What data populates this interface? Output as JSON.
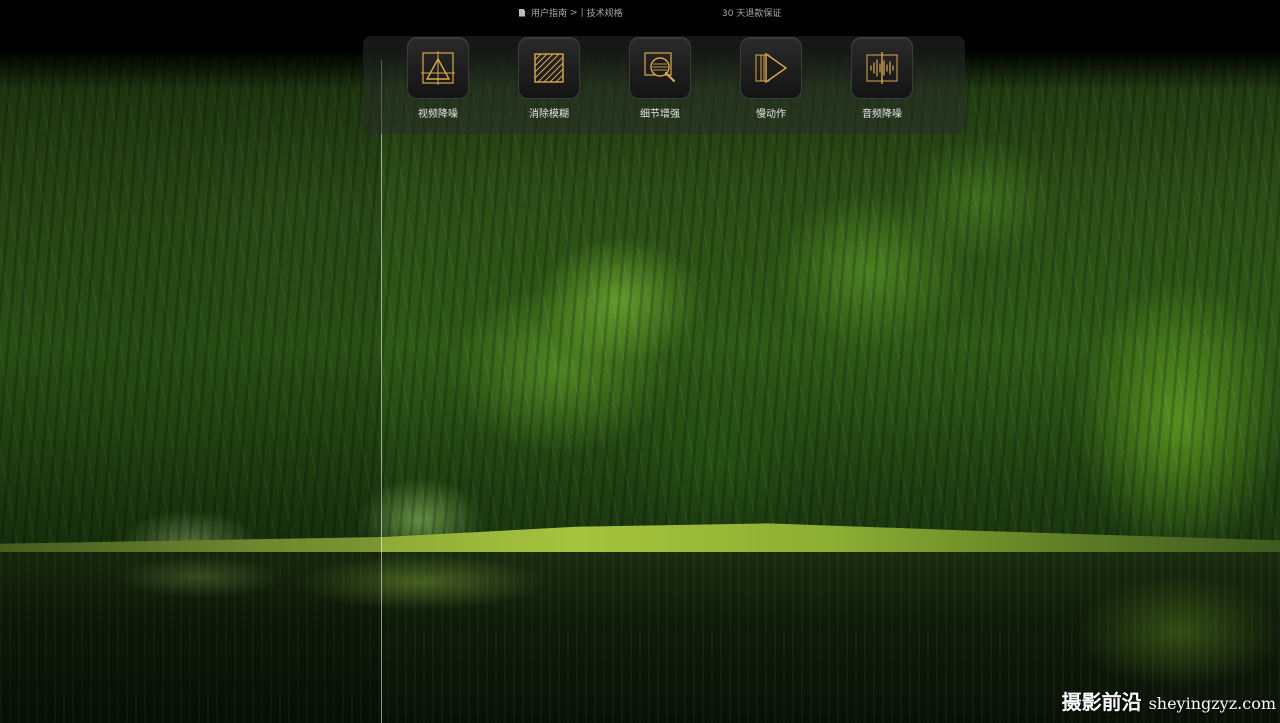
{
  "topbar": {
    "nav": [
      "用户指南",
      "|",
      "技术规格"
    ],
    "separator": ">",
    "guarantee": "30 天退款保证"
  },
  "features": [
    {
      "label": "视频降噪",
      "icon": "triangle-frame-icon"
    },
    {
      "label": "消除模糊",
      "icon": "hatched-square-icon"
    },
    {
      "label": "细节增强",
      "icon": "magnifier-icon"
    },
    {
      "label": "慢动作",
      "icon": "play-frames-icon"
    },
    {
      "label": "音频降噪",
      "icon": "waveform-icon"
    }
  ],
  "colors": {
    "icon_accent": "#d9a84a",
    "label": "#e6e6e6"
  },
  "watermark": {
    "brand": "摄影前沿",
    "url": "sheyingzyz.com"
  }
}
